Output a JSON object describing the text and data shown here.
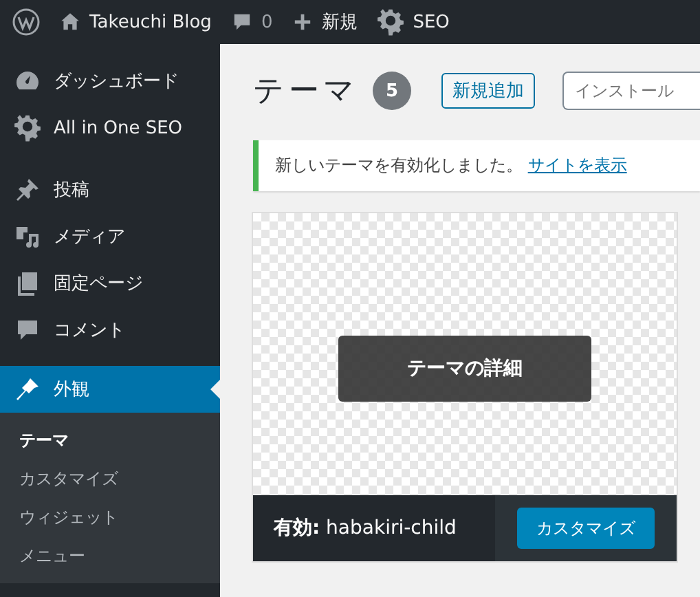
{
  "admin_bar": [
    {
      "kind": "logo"
    },
    {
      "kind": "site",
      "label": "Takeuchi Blog"
    },
    {
      "kind": "comments",
      "label": "0"
    },
    {
      "kind": "new",
      "label": "新規"
    },
    {
      "kind": "seo",
      "label": "SEO"
    }
  ],
  "sidebar": {
    "groups": [
      {
        "items": [
          {
            "label": "ダッシュボード",
            "selected": false
          },
          {
            "label": "All in One SEO",
            "selected": false
          }
        ]
      },
      {
        "items": [
          {
            "label": "投稿",
            "selected": false
          },
          {
            "label": "メディア",
            "selected": false
          },
          {
            "label": "固定ページ",
            "selected": false
          },
          {
            "label": "コメント",
            "selected": false
          }
        ]
      },
      {
        "items": [
          {
            "label": "外観",
            "selected": true,
            "children": [
              {
                "label": "テーマ",
                "selected": true
              },
              {
                "label": "カスタマイズ",
                "selected": false
              },
              {
                "label": "ウィジェット",
                "selected": false
              },
              {
                "label": "メニュー",
                "selected": false
              }
            ]
          }
        ]
      }
    ]
  },
  "page": {
    "title": "テーマ",
    "count": "5",
    "add_button": "新規追加",
    "search": {
      "placeholder": "インストール"
    }
  },
  "notice": {
    "text": "新しいテーマを有効化しました。",
    "link": "サイトを表示"
  },
  "theme_card": {
    "details_button": "テーマの詳細",
    "active_label": "**有効:** habakiri-child",
    "customize_button": "カスタマイズ"
  }
}
